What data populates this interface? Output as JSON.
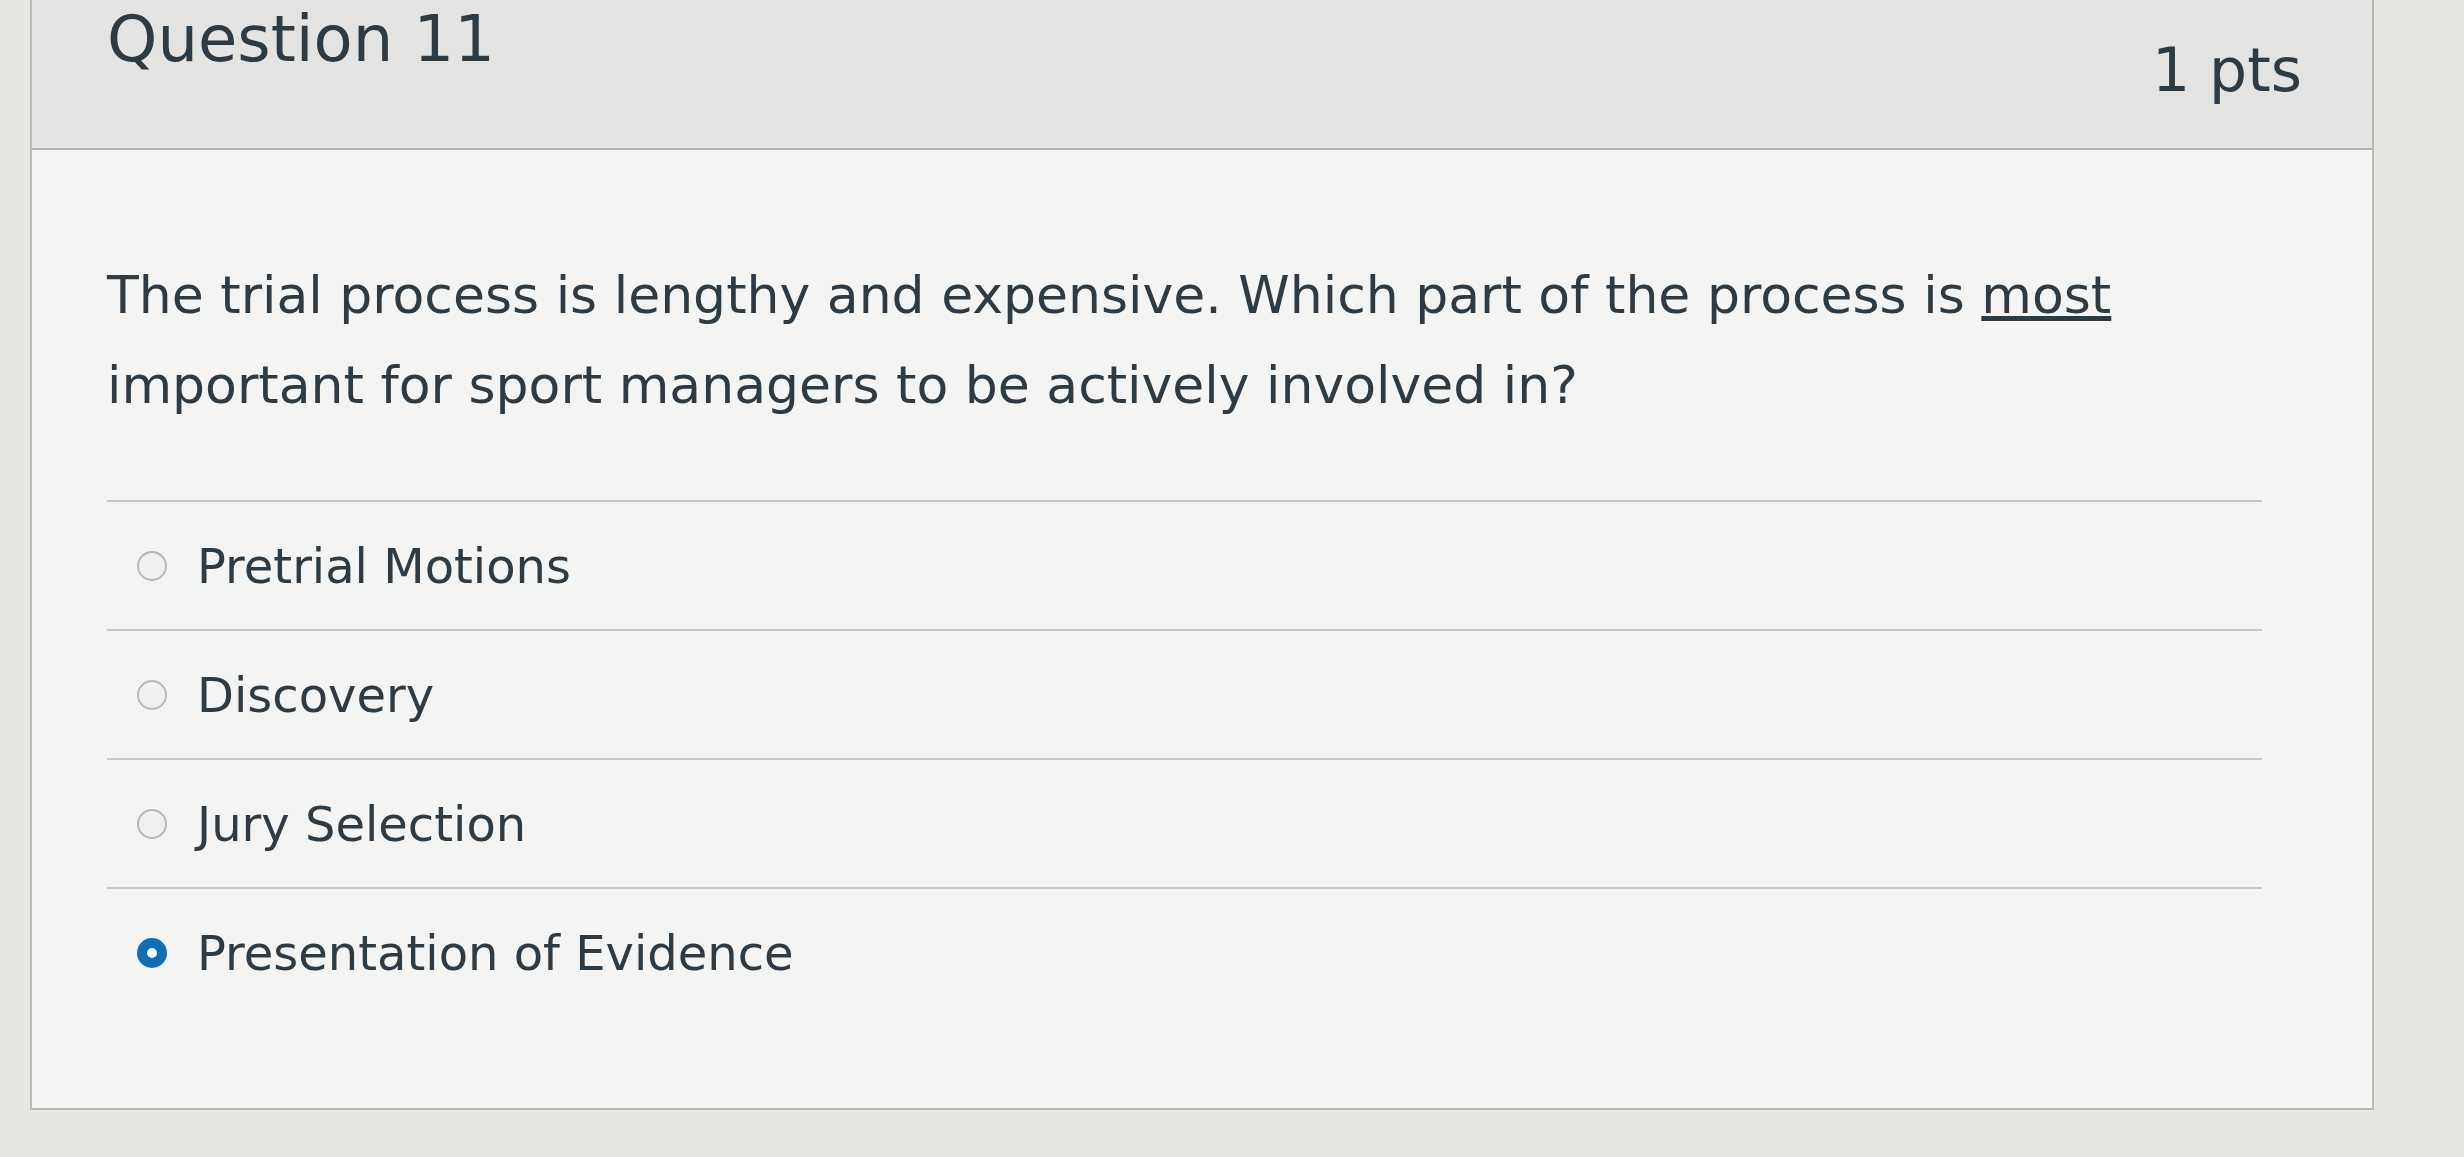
{
  "question": {
    "title": "Question 11",
    "points": "1 pts",
    "text": [
      {
        "text": "The trial process is lengthy and expensive. Which part of the process is ",
        "underlined": false
      },
      {
        "text": "most",
        "underlined": true
      },
      {
        "text": " important for sport managers to be actively involved in?",
        "underlined": false
      }
    ],
    "answers": [
      {
        "label": "Pretrial Motions",
        "selected": false
      },
      {
        "label": "Discovery",
        "selected": false
      },
      {
        "label": "Jury Selection",
        "selected": false
      },
      {
        "label": "Presentation of Evidence",
        "selected": true
      }
    ]
  }
}
